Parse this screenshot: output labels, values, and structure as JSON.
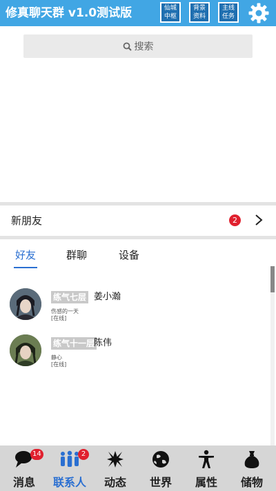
{
  "header": {
    "title": "修真聊天群 v1.0测试版",
    "buttons": [
      {
        "line1": "仙城",
        "line2": "中枢"
      },
      {
        "line1": "背景",
        "line2": "资料"
      },
      {
        "line1": "主线",
        "line2": "任务"
      }
    ],
    "settings_icon": "gear-icon"
  },
  "search": {
    "placeholder": "搜索",
    "icon": "search-icon"
  },
  "new_friends": {
    "label": "新朋友",
    "badge": "2",
    "icon": "chevron-right-icon"
  },
  "tabs": [
    {
      "label": "好友",
      "active": true
    },
    {
      "label": "群聊",
      "active": false
    },
    {
      "label": "设备",
      "active": false
    }
  ],
  "friends": [
    {
      "realm": "练气七层",
      "name": "姜小瀚",
      "signature": "伤感的一天",
      "status": "[在线]"
    },
    {
      "realm": "练气十一层",
      "name": "陈伟",
      "signature": "静心",
      "status": "[在线]"
    }
  ],
  "bottom_nav": [
    {
      "label": "消息",
      "badge": "14",
      "icon": "chat-bubble-icon",
      "active": false
    },
    {
      "label": "联系人",
      "badge": "2",
      "icon": "contacts-icon",
      "active": true
    },
    {
      "label": "动态",
      "badge": "",
      "icon": "moments-icon",
      "active": false
    },
    {
      "label": "世界",
      "badge": "",
      "icon": "world-icon",
      "active": false
    },
    {
      "label": "属性",
      "badge": "",
      "icon": "person-icon",
      "active": false
    },
    {
      "label": "储物",
      "badge": "",
      "icon": "bag-icon",
      "active": false
    }
  ],
  "colors": {
    "header": "#41a6e4",
    "accent": "#2a6fd1",
    "badge": "#e0202e"
  }
}
